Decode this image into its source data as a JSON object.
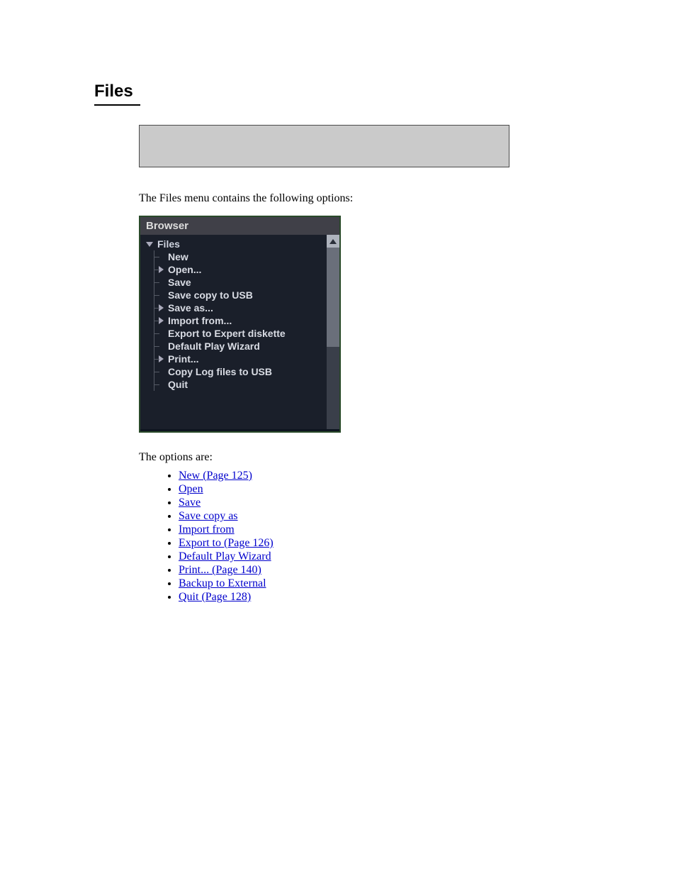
{
  "heading": "Files",
  "lead": "The Files menu contains the following options:",
  "browser": {
    "title": "Browser",
    "root": "Files",
    "items": [
      {
        "label": "New",
        "expandable": false
      },
      {
        "label": "Open...",
        "expandable": true
      },
      {
        "label": "Save",
        "expandable": false
      },
      {
        "label": "Save copy to USB",
        "expandable": false
      },
      {
        "label": "Save as...",
        "expandable": true
      },
      {
        "label": "Import from...",
        "expandable": true
      },
      {
        "label": "Export to Expert diskette",
        "expandable": false
      },
      {
        "label": "Default Play Wizard",
        "expandable": false
      },
      {
        "label": "Print...",
        "expandable": true
      },
      {
        "label": "Copy Log files to USB",
        "expandable": false
      },
      {
        "label": "Quit",
        "expandable": false
      }
    ]
  },
  "list_intro": "The options are:",
  "list": [
    "New (Page 125)",
    "Open",
    "Save",
    "Save copy as",
    "Import from",
    "Export to (Page 126)",
    "Default Play Wizard",
    "Print... (Page 140)",
    "Backup to External",
    "Quit (Page 128)"
  ]
}
